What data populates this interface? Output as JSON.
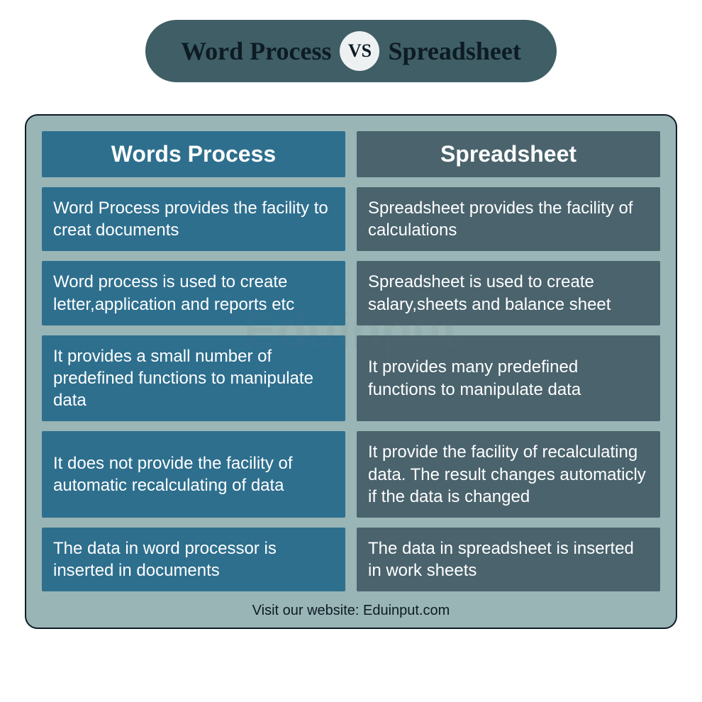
{
  "title": {
    "left": "Word Process",
    "vs": "VS",
    "right": "Spreadsheet"
  },
  "columns": {
    "left_header": "Words Process",
    "right_header": "Spreadsheet"
  },
  "rows": [
    {
      "left": "Word Process provides the facility to creat documents",
      "right": "Spreadsheet provides the facility of calculations"
    },
    {
      "left": "Word process is used to create letter,application and reports etc",
      "right": "Spreadsheet is used to create salary,sheets and balance sheet"
    },
    {
      "left": "It provides a small number of predefined functions to manipulate data",
      "right": "It provides many  predefined functions to manipulate data"
    },
    {
      "left": "It does not provide the facility of automatic recalculating of data",
      "right": "It provide the facility of recalculating data. The result changes automaticly if the data is changed"
    },
    {
      "left": "The data in word processor is inserted in documents",
      "right": "The data in spreadsheet is inserted in work sheets"
    }
  ],
  "footer": "Visit our website: Eduinput.com",
  "watermark": "Eduinput"
}
